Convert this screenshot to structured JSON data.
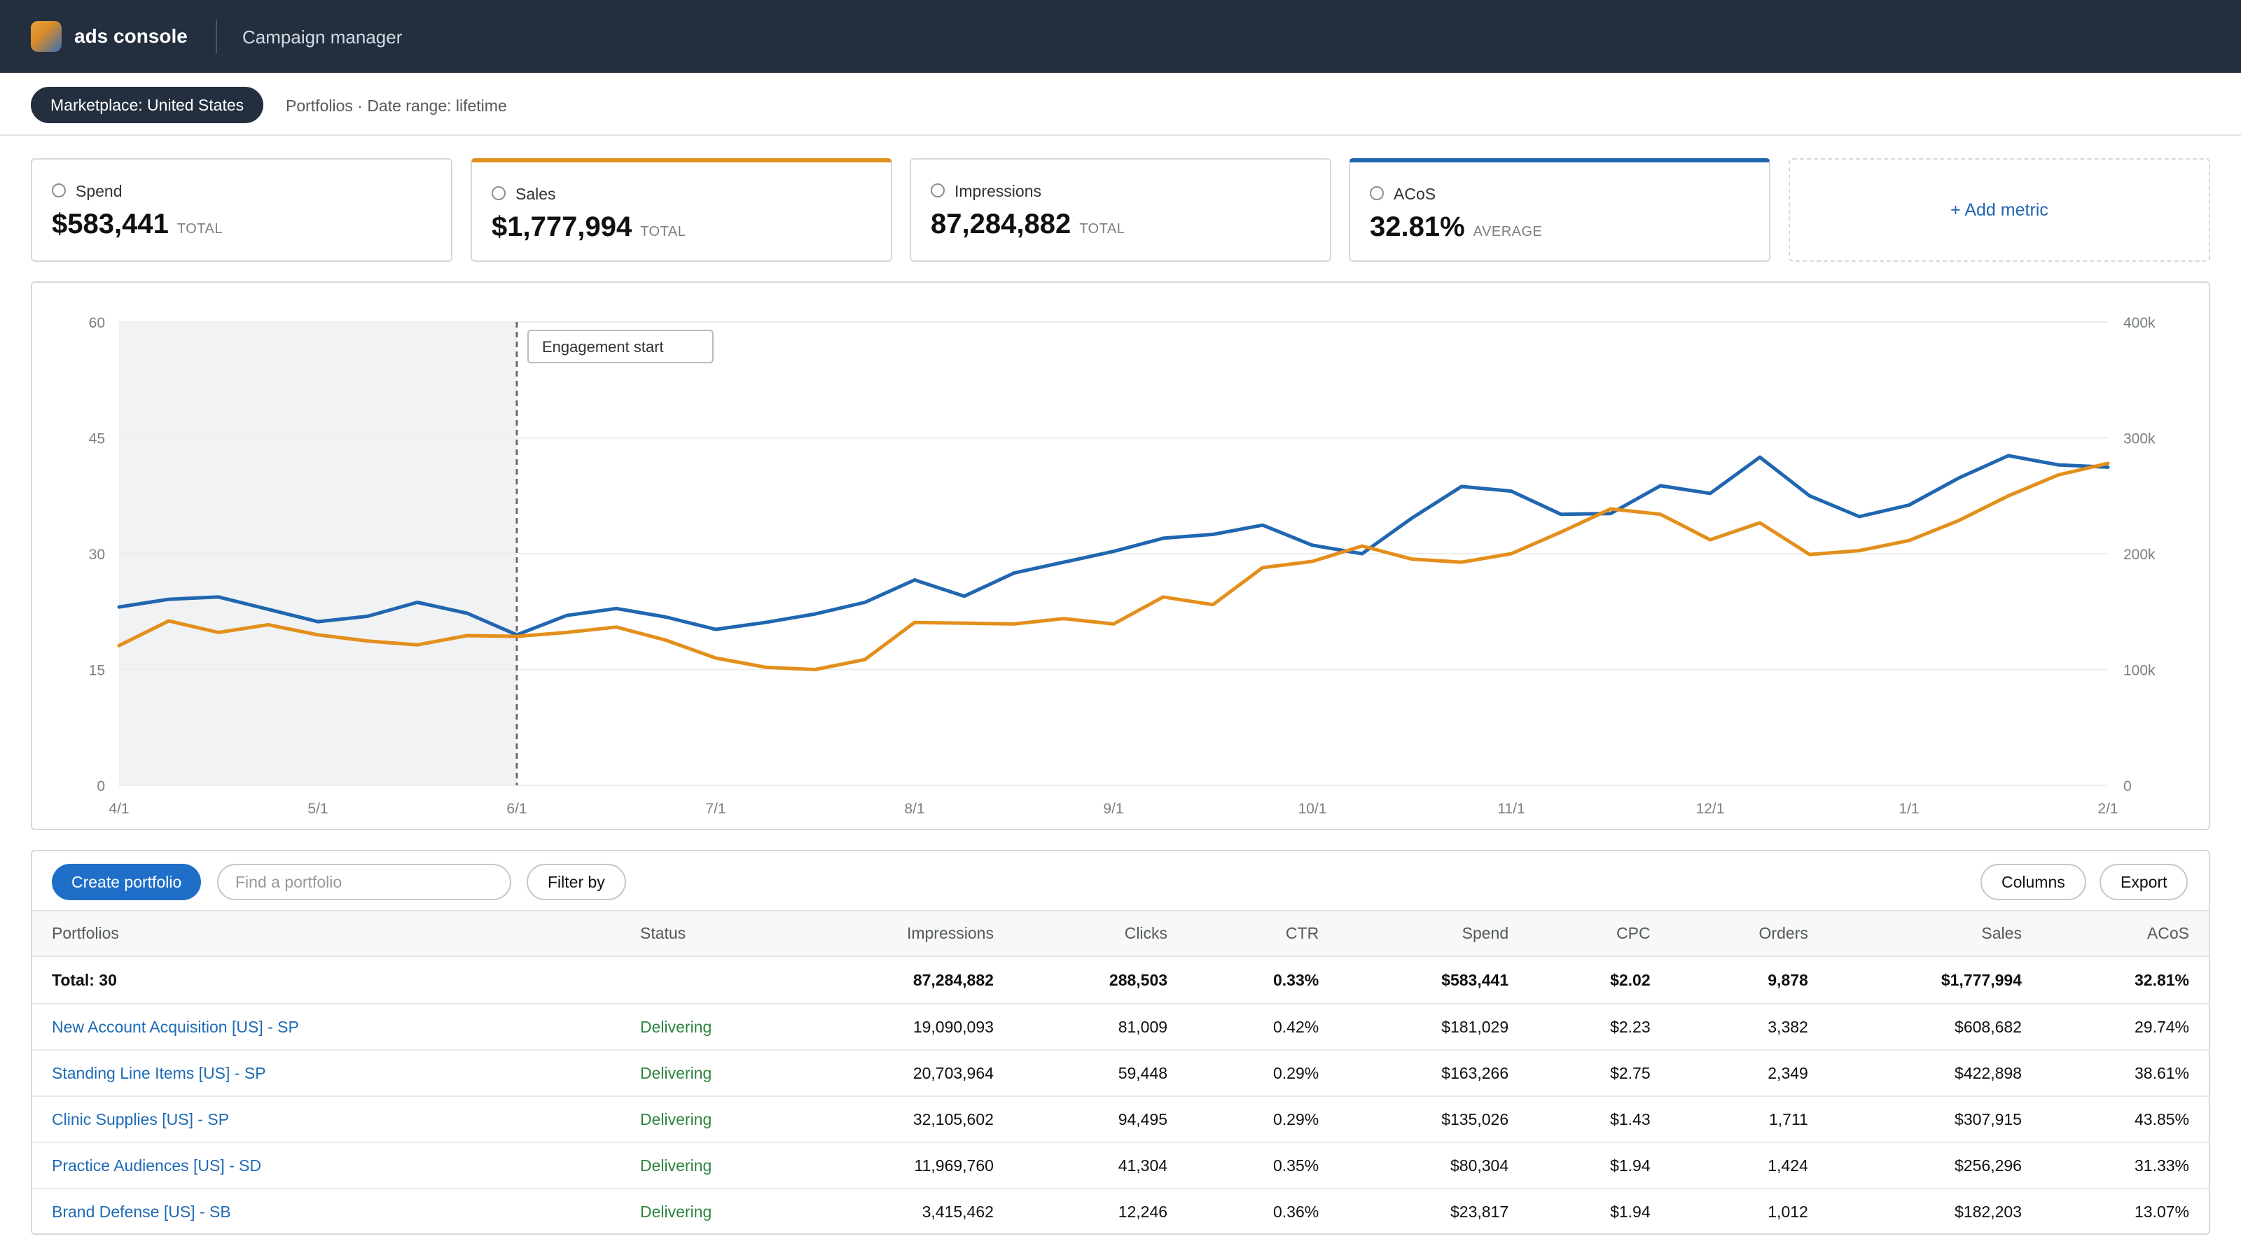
{
  "header": {
    "app_name": "ads console",
    "page_label": "Campaign manager"
  },
  "filters": {
    "marketplace": "Marketplace: United States",
    "context": "Portfolios · Date range: lifetime"
  },
  "metrics": [
    {
      "label": "Spend",
      "value": "$583,441",
      "suffix": "TOTAL",
      "accent": ""
    },
    {
      "label": "Sales",
      "value": "$1,777,994",
      "suffix": "TOTAL",
      "accent": "#e38f1c"
    },
    {
      "label": "Impressions",
      "value": "87,284,882",
      "suffix": "TOTAL",
      "accent": ""
    },
    {
      "label": "ACoS",
      "value": "32.81%",
      "suffix": "AVERAGE",
      "accent": "#2166b0"
    }
  ],
  "add_metric_label": "+ Add metric",
  "chart_data": {
    "type": "line",
    "x_ticks": [
      "4/1",
      "5/1",
      "6/1",
      "7/1",
      "8/1",
      "9/1",
      "10/1",
      "11/1",
      "12/1",
      "1/1",
      "2/1"
    ],
    "left_axis": {
      "ticks": [
        "0",
        "15",
        "30",
        "45",
        "60"
      ],
      "ylim": [
        0,
        60
      ]
    },
    "right_axis": {
      "ticks": [
        "0",
        "100k",
        "200k",
        "300k",
        "400k"
      ],
      "ylim": [
        0,
        400000
      ]
    },
    "shaded_region": {
      "from": "4/1",
      "to": "6/1"
    },
    "annotation": {
      "label": "Engagement start",
      "at": "6/1"
    },
    "grid": true,
    "series": [
      {
        "color": "#2166b0",
        "axis": "left",
        "values": [
          23.1,
          24.1,
          24.4,
          22.8,
          21.2,
          21.9,
          23.7,
          22.3,
          19.5,
          22.0,
          22.9,
          21.8,
          20.2,
          21.1,
          22.2,
          23.7,
          26.6,
          24.5,
          27.5,
          28.9,
          30.3,
          32.0,
          32.5,
          33.7,
          31.1,
          30.0,
          34.6,
          38.7,
          38.1,
          35.1,
          35.2,
          38.8,
          37.8,
          42.5,
          37.5,
          34.8,
          36.3,
          39.8,
          42.7,
          41.5,
          41.2
        ]
      },
      {
        "color": "#e38f1c",
        "axis": "left",
        "values": [
          18.1,
          21.3,
          19.8,
          20.8,
          19.5,
          18.7,
          18.2,
          19.4,
          19.3,
          19.8,
          20.5,
          18.8,
          16.5,
          15.3,
          15.0,
          16.3,
          21.1,
          21.0,
          20.9,
          21.6,
          20.9,
          24.4,
          23.4,
          28.2,
          29.0,
          31.0,
          29.3,
          28.9,
          30.0,
          32.8,
          35.8,
          35.1,
          31.8,
          34.0,
          29.9,
          30.4,
          31.7,
          34.3,
          37.5,
          40.2,
          41.7
        ]
      }
    ]
  },
  "table": {
    "create_label": "Create portfolio",
    "search_placeholder": "Find a portfolio",
    "filter_label": "Filter by",
    "columns_label": "Columns",
    "export_label": "Export",
    "headers": [
      "Portfolios",
      "Status",
      "Impressions",
      "Clicks",
      "CTR",
      "Spend",
      "CPC",
      "Orders",
      "Sales",
      "ACoS"
    ],
    "total": [
      "Total: 30",
      "",
      "87,284,882",
      "288,503",
      "0.33%",
      "$583,441",
      "$2.02",
      "9,878",
      "$1,777,994",
      "32.81%"
    ],
    "rows": [
      [
        "New Account Acquisition [US] - SP",
        "Delivering",
        "19,090,093",
        "81,009",
        "0.42%",
        "$181,029",
        "$2.23",
        "3,382",
        "$608,682",
        "29.74%"
      ],
      [
        "Standing Line Items [US] - SP",
        "Delivering",
        "20,703,964",
        "59,448",
        "0.29%",
        "$163,266",
        "$2.75",
        "2,349",
        "$422,898",
        "38.61%"
      ],
      [
        "Clinic Supplies [US] - SP",
        "Delivering",
        "32,105,602",
        "94,495",
        "0.29%",
        "$135,026",
        "$1.43",
        "1,711",
        "$307,915",
        "43.85%"
      ],
      [
        "Practice Audiences [US] - SD",
        "Delivering",
        "11,969,760",
        "41,304",
        "0.35%",
        "$80,304",
        "$1.94",
        "1,424",
        "$256,296",
        "31.33%"
      ],
      [
        "Brand Defense [US] - SB",
        "Delivering",
        "3,415,462",
        "12,246",
        "0.36%",
        "$23,817",
        "$1.94",
        "1,012",
        "$182,203",
        "13.07%"
      ]
    ]
  }
}
